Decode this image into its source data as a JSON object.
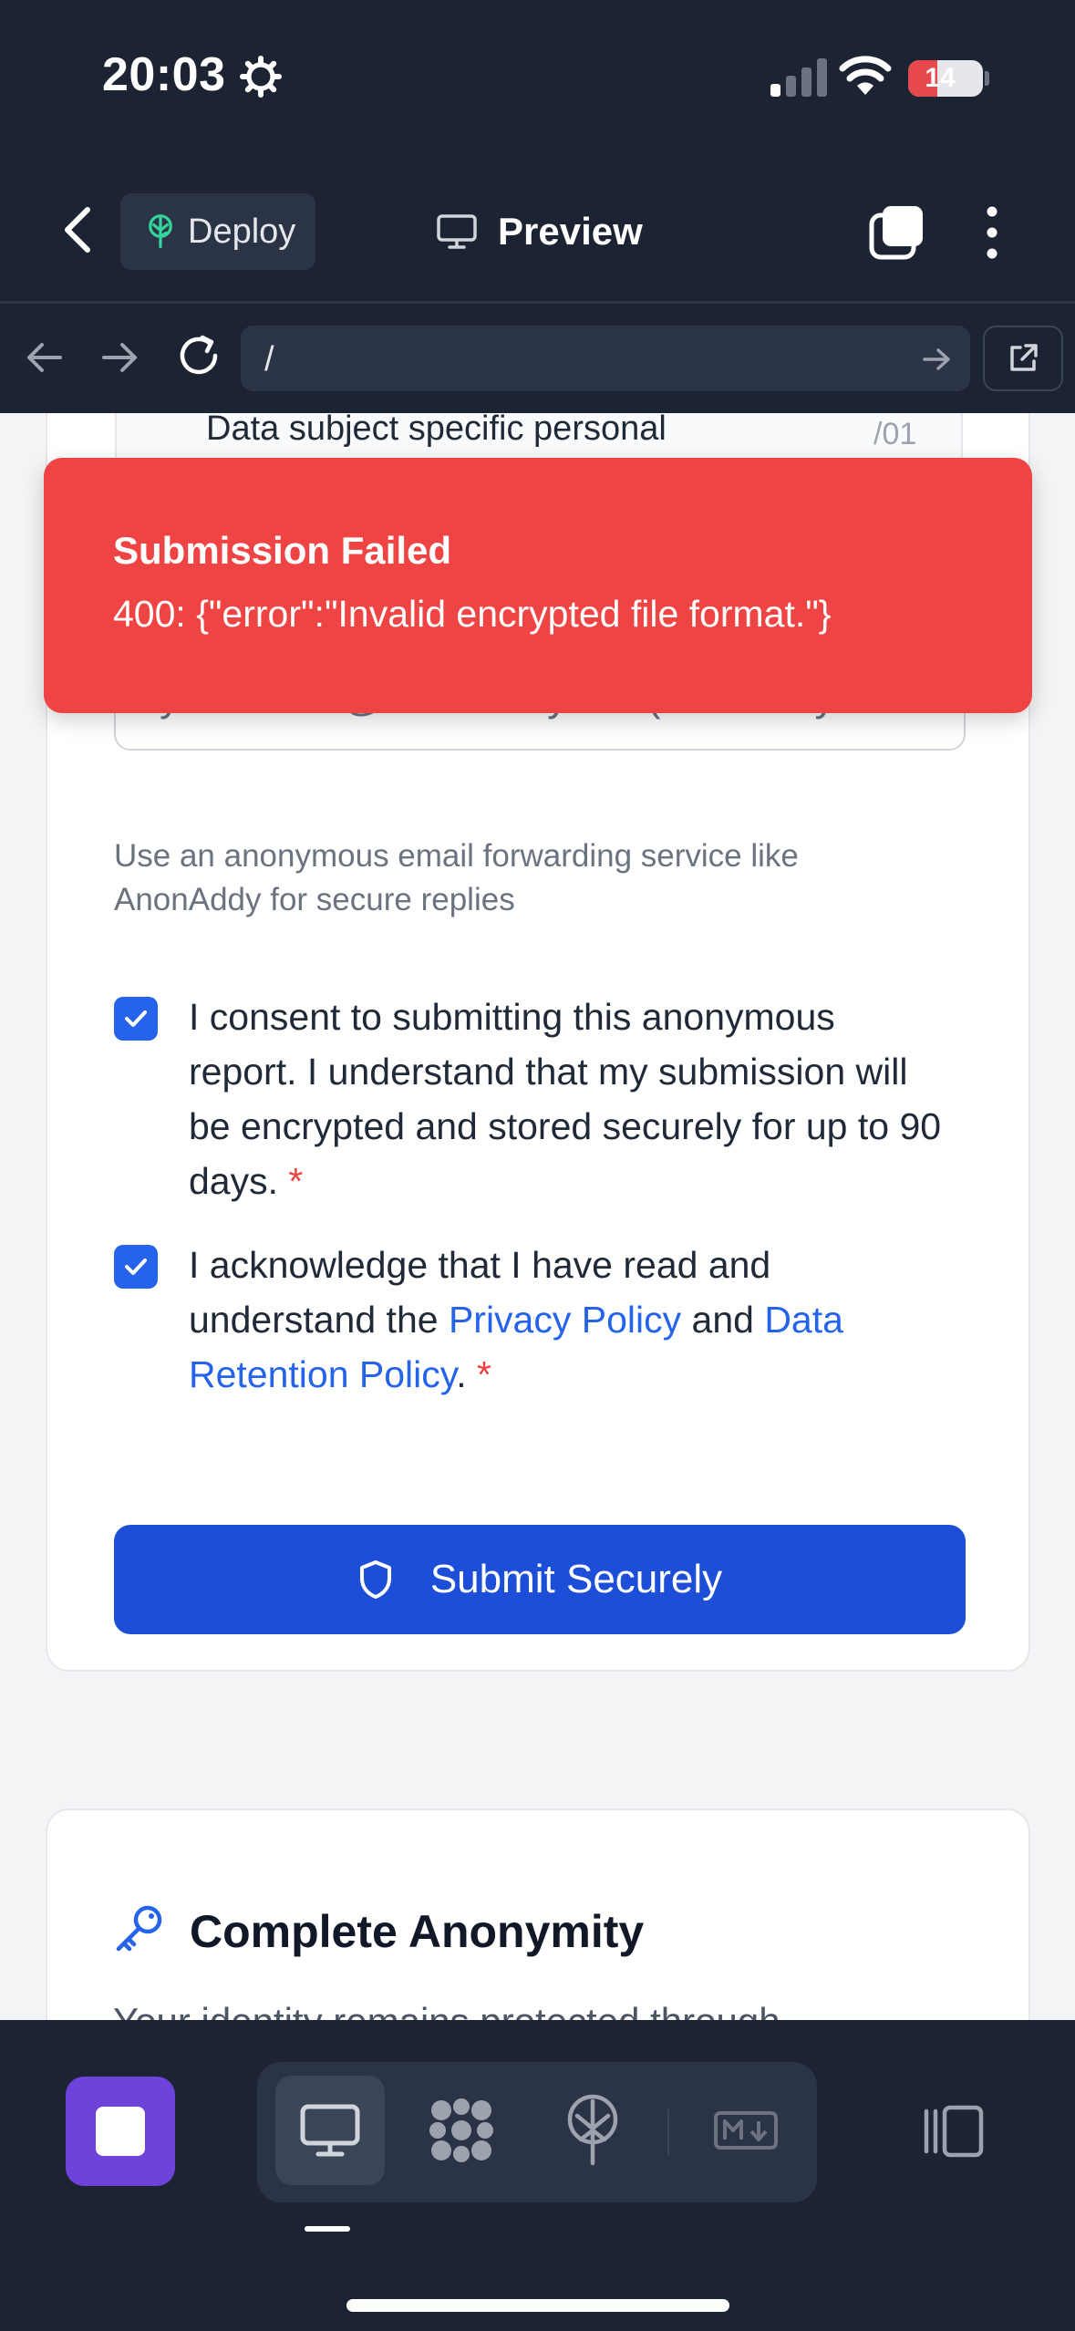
{
  "status_bar": {
    "time": "20:03",
    "battery": "14",
    "battery_level": 0.14
  },
  "app_header": {
    "deploy_label": "Deploy",
    "preview_label": "Preview"
  },
  "url_bar": {
    "url": "/"
  },
  "form": {
    "peek_row_text": "Data subject specific personal",
    "peek_row_extra": "/01",
    "email_placeholder": "your-alias@anonaddy.me (for anonymous replies)",
    "email_help": "Use an anonymous email forwarding service like AnonAddy for secure replies",
    "consent": {
      "text": "I consent to submitting this anonymous report. I understand that my submission will be encrypted and stored securely for up to 90 days.",
      "required_mark": "*",
      "checked": true
    },
    "acknowledge": {
      "prefix": "I acknowledge that I have read and understand the ",
      "privacy_link": "Privacy Policy",
      "and": " and ",
      "retention_link": "Data Retention Policy",
      "suffix": ".",
      "required_mark": "*",
      "checked": true
    },
    "submit_label": "Submit Securely"
  },
  "info_card": {
    "title": "Complete Anonymity",
    "body": "Your identity remains protected through"
  },
  "toast": {
    "title": "Submission Failed",
    "message": "400: {\"error\":\"Invalid encrypted file format.\"}"
  },
  "colors": {
    "header_bg": "#1c2333",
    "toast_bg": "#ef4444",
    "primary": "#1d4ed8",
    "link": "#2563eb",
    "app_icon": "#6d43d9"
  },
  "bottom_bar": {
    "icons": [
      "app-icon",
      "desktop-icon",
      "blocks-icon",
      "deploy-icon",
      "markdown-icon",
      "panel-icon"
    ],
    "active": "desktop-icon"
  }
}
